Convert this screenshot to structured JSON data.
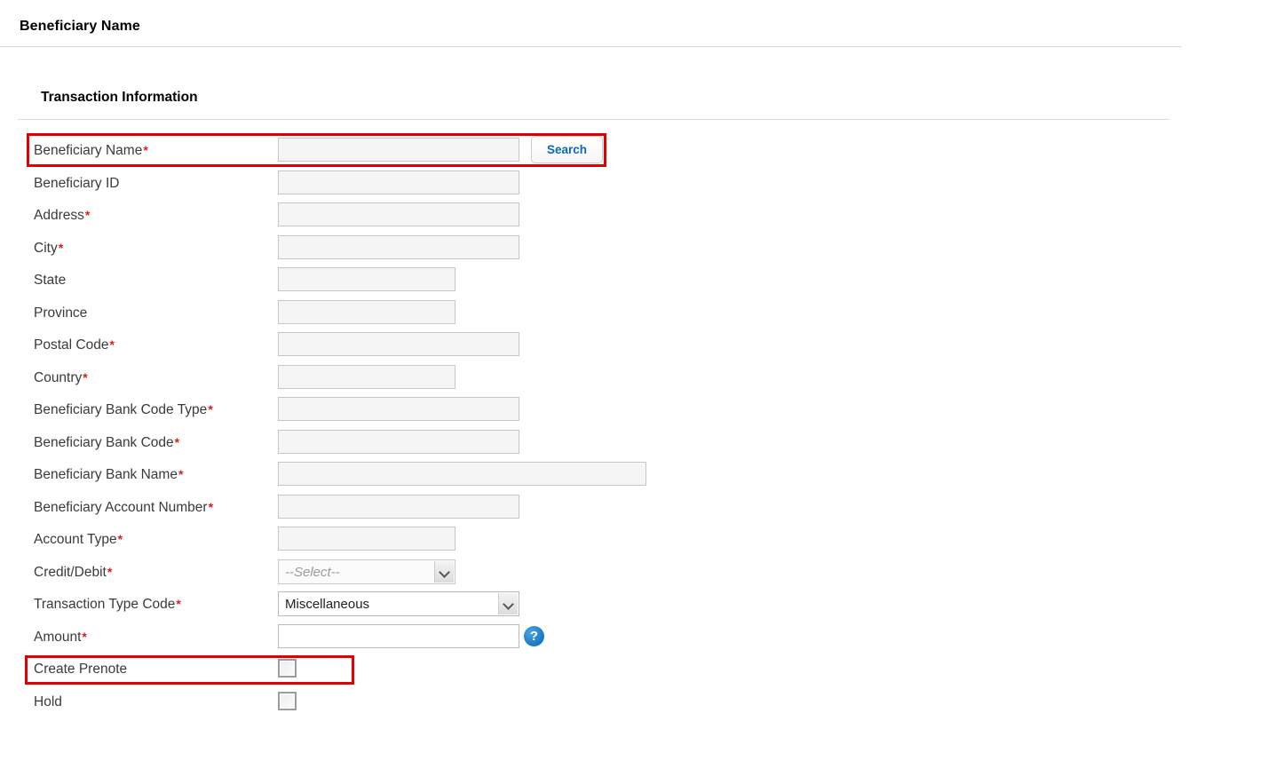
{
  "page": {
    "title": "Beneficiary Name",
    "section_title": "Transaction Information"
  },
  "form": {
    "search_button_label": "Search",
    "help_icon_glyph": "?",
    "rows": [
      {
        "label": "Beneficiary Name",
        "required": true,
        "control": "text",
        "width": "w-std",
        "value": "",
        "enabled": false,
        "has_search": true
      },
      {
        "label": "Beneficiary ID",
        "required": false,
        "control": "text",
        "width": "w-std",
        "value": "",
        "enabled": false
      },
      {
        "label": "Address",
        "required": true,
        "control": "text",
        "width": "w-std",
        "value": "",
        "enabled": false
      },
      {
        "label": "City",
        "required": true,
        "control": "text",
        "width": "w-std",
        "value": "",
        "enabled": false
      },
      {
        "label": "State",
        "required": false,
        "control": "text",
        "width": "w-short",
        "value": "",
        "enabled": false
      },
      {
        "label": "Province",
        "required": false,
        "control": "text",
        "width": "w-short",
        "value": "",
        "enabled": false
      },
      {
        "label": "Postal Code",
        "required": true,
        "control": "text",
        "width": "w-std",
        "value": "",
        "enabled": false
      },
      {
        "label": "Country",
        "required": true,
        "control": "text",
        "width": "w-short",
        "value": "",
        "enabled": false
      },
      {
        "label": "Beneficiary Bank Code Type",
        "required": true,
        "control": "text",
        "width": "w-std",
        "value": "",
        "enabled": false
      },
      {
        "label": "Beneficiary Bank Code",
        "required": true,
        "control": "text",
        "width": "w-std",
        "value": "",
        "enabled": false
      },
      {
        "label": "Beneficiary Bank Name",
        "required": true,
        "control": "text",
        "width": "w-wide",
        "value": "",
        "enabled": false
      },
      {
        "label": "Beneficiary Account Number",
        "required": true,
        "control": "text",
        "width": "w-std",
        "value": "",
        "enabled": false
      },
      {
        "label": "Account Type",
        "required": true,
        "control": "text",
        "width": "w-short",
        "value": "",
        "enabled": false
      },
      {
        "label": "Credit/Debit",
        "required": true,
        "control": "select",
        "width": "w-sel-short",
        "value": "--Select--",
        "enabled": false
      },
      {
        "label": "Transaction Type Code",
        "required": true,
        "control": "select",
        "width": "w-sel-std",
        "value": "Miscellaneous",
        "enabled": true
      },
      {
        "label": "Amount",
        "required": true,
        "control": "text",
        "width": "w-std",
        "value": "",
        "enabled": true,
        "has_help": true
      },
      {
        "label": "Create Prenote",
        "required": false,
        "control": "checkbox",
        "checked": false
      },
      {
        "label": "Hold",
        "required": false,
        "control": "checkbox",
        "checked": false
      }
    ]
  },
  "highlights": [
    {
      "name": "beneficiary-name-row",
      "color": "#e00000"
    },
    {
      "name": "create-prenote-row",
      "color": "#e00000"
    }
  ]
}
